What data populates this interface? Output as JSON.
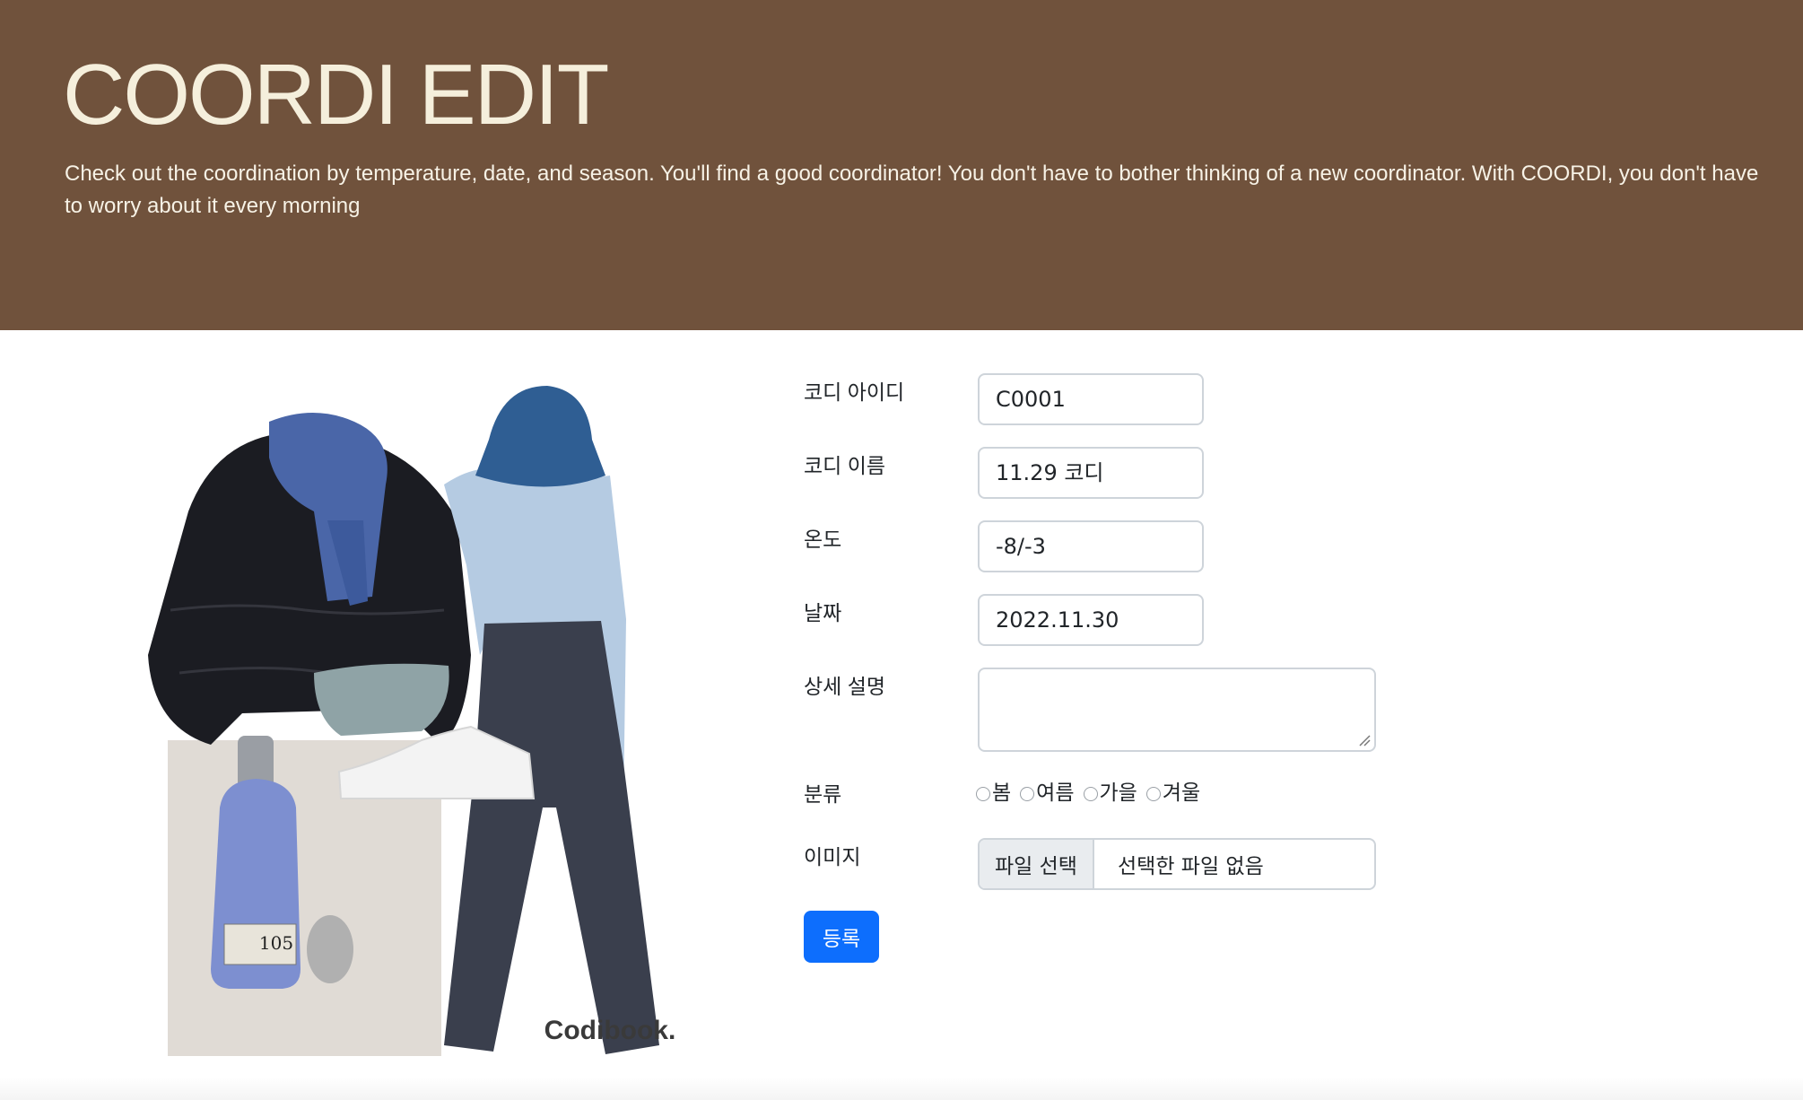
{
  "hero": {
    "title": "COORDI EDIT",
    "description": "Check out the coordination by temperature, date, and season. You'll find a good coordinator! You don't have to bother thinking of a new coordinator. With COORDI, you don't have to worry about it every morning"
  },
  "picture": {
    "watermark": "Codibook.",
    "perfume_label": "105"
  },
  "form": {
    "id_label": "코디 아이디",
    "id_value": "C0001",
    "name_label": "코디 이름",
    "name_value": "11.29 코디",
    "temp_label": "온도",
    "temp_value": "-8/-3",
    "date_label": "날짜",
    "date_value": "2022.11.30",
    "detail_label": "상세 설명",
    "detail_value": "",
    "season_label": "분류",
    "seasons": [
      "봄",
      "여름",
      "가을",
      "겨울"
    ],
    "image_label": "이미지",
    "file_button": "파일 선택",
    "file_status": "선택한 파일 없음",
    "submit_label": "등록"
  },
  "colors": {
    "hero_bg": "#70523c",
    "hero_title": "#f5efdc",
    "primary": "#0d6efd"
  }
}
